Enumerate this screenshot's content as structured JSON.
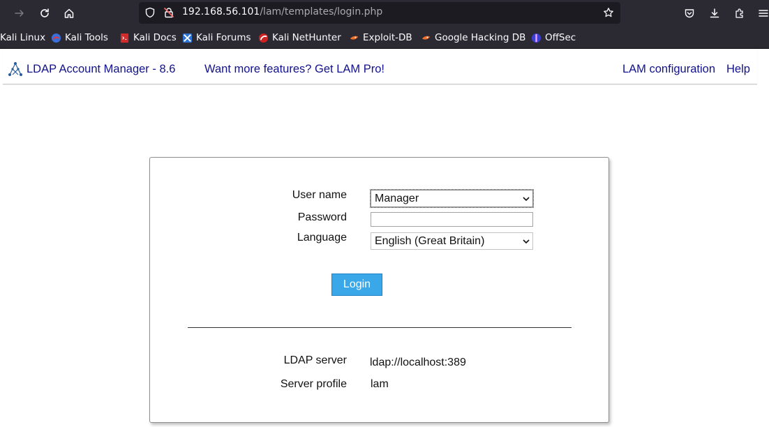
{
  "browser": {
    "url_host": "192.168.56.101",
    "url_path": "/lam/templates/login.php",
    "icons": [
      "forward-icon",
      "reload-icon",
      "home-icon",
      "shield-icon",
      "insecure-lock-icon",
      "bookmark-star-icon",
      "pocket-icon",
      "download-icon",
      "extensions-icon",
      "menu-icon"
    ]
  },
  "bookmarks": [
    {
      "label": "Kali Linux"
    },
    {
      "label": "Kali Tools"
    },
    {
      "label": "Kali Docs"
    },
    {
      "label": "Kali Forums"
    },
    {
      "label": "Kali NetHunter"
    },
    {
      "label": "Exploit-DB"
    },
    {
      "label": "Google Hacking DB"
    },
    {
      "label": "OffSec"
    }
  ],
  "header": {
    "title": "LDAP Account Manager - 8.6",
    "promo": "Want more features? Get LAM Pro!",
    "config_link": "LAM configuration",
    "help_link": "Help",
    "link_color": "#12128a"
  },
  "login": {
    "username_label": "User name",
    "username_value": "Manager",
    "password_label": "Password",
    "password_value": "",
    "language_label": "Language",
    "language_value": "English (Great Britain)",
    "login_button": "Login",
    "button_color": "#3aa7e8"
  },
  "server_info": {
    "ldap_server_label": "LDAP server",
    "ldap_server_value": "ldap://localhost:389",
    "profile_label": "Server profile",
    "profile_value": "lam"
  }
}
